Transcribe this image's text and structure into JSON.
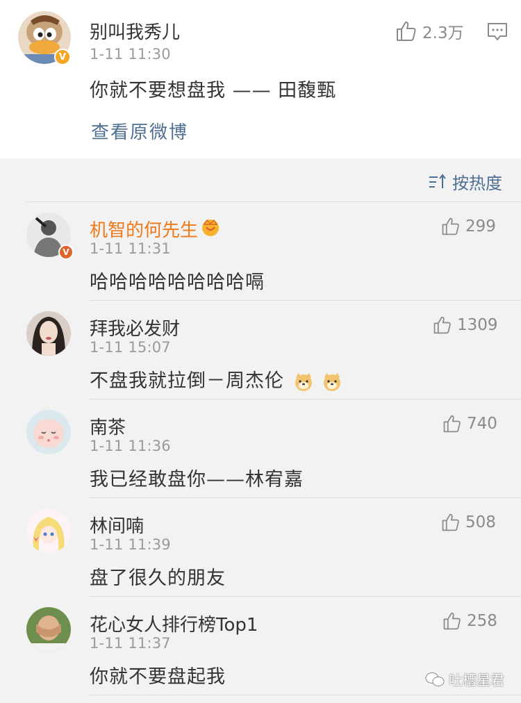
{
  "post": {
    "username": "别叫我秀儿",
    "time": "1-11 11:30",
    "content": "你就不要想盘我 —— 田馥甄",
    "likes": "2.3万",
    "view_original": "查看原微博"
  },
  "sort_label": "按热度",
  "comments": [
    {
      "username": "机智的何先生",
      "time": "1-11 11:31",
      "content": "哈哈哈哈哈哈哈哈嗝",
      "likes": "299",
      "vip": true
    },
    {
      "username": "拜我必发财",
      "time": "1-11 15:07",
      "content": "不盘我就拉倒－周杰伦",
      "likes": "1309",
      "vip": false
    },
    {
      "username": "南茶",
      "time": "1-11 11:36",
      "content": "我已经敢盘你——林宥嘉",
      "likes": "740",
      "vip": false
    },
    {
      "username": "林间喃",
      "time": "1-11 11:39",
      "content": "盘了很久的朋友",
      "likes": "508",
      "vip": false
    },
    {
      "username": "花心女人排行榜Top1",
      "time": "1-11 11:37",
      "content": "你就不要盘起我",
      "likes": "258",
      "vip": false
    }
  ],
  "watermark": "吐槽星君",
  "icons": {
    "like": "thumbs-up-icon",
    "comment": "comment-icon",
    "sort": "sort-icon",
    "verified": "verified-badge-icon",
    "vip_crown": "vip-crown-icon",
    "emoji": "doge-emoji-icon"
  },
  "colors": {
    "vip_name": "#f07a1a",
    "link": "#4f6f92",
    "verified_badge": "#f5a623",
    "vip_badge": "#e0642a"
  }
}
